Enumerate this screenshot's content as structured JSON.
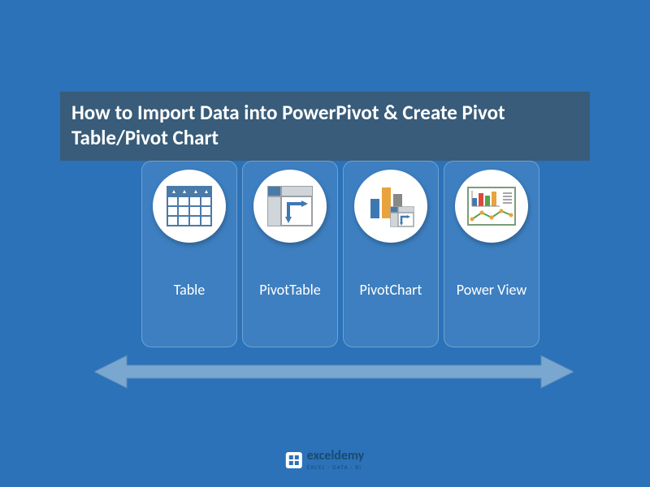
{
  "title": "How to Import Data into PowerPivot & Create Pivot Table/Pivot Chart",
  "cards": [
    {
      "label": "Table",
      "icon": "table-icon"
    },
    {
      "label": "PivotTable",
      "icon": "pivottable-icon"
    },
    {
      "label": "PivotChart",
      "icon": "pivotchart-icon"
    },
    {
      "label": "Power View",
      "icon": "powerview-icon"
    }
  ],
  "footer": {
    "brand": "exceldemy",
    "tagline": "EXCEL · DATA · BI"
  },
  "colors": {
    "bg": "#2b72b9",
    "title_bg": "#385c79",
    "card_bg": "#3d7fc0",
    "arrow": "#7aa7d0"
  }
}
